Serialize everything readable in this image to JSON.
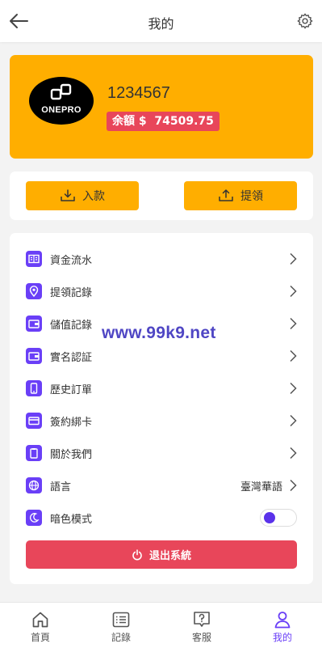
{
  "header": {
    "title": "我的",
    "back_icon": "arrow-left-icon",
    "settings_icon": "gear-icon"
  },
  "profile": {
    "logo_text": "ONEPRO",
    "username": "1234567",
    "balance_label": "余額",
    "balance_currency": "$",
    "balance_value": "74509.75"
  },
  "actions": {
    "deposit_label": "入款",
    "withdraw_label": "提領"
  },
  "menu": {
    "items": [
      {
        "label": "資金流水",
        "icon": "ledger-icon"
      },
      {
        "label": "提領記錄",
        "icon": "location-pin-icon"
      },
      {
        "label": "儲值記錄",
        "icon": "wallet-icon"
      },
      {
        "label": "實名認証",
        "icon": "id-card-icon"
      },
      {
        "label": "歷史訂單",
        "icon": "phone-icon"
      },
      {
        "label": "簽約綁卡",
        "icon": "credit-card-icon"
      },
      {
        "label": "關於我們",
        "icon": "clipboard-icon"
      },
      {
        "label": "語言",
        "icon": "globe-icon",
        "value": "臺灣華語"
      },
      {
        "label": "暗色模式",
        "icon": "moon-icon",
        "toggle": true
      }
    ],
    "logout_label": "退出系統"
  },
  "watermark": "www.99k9.net",
  "tabs": [
    {
      "label": "首頁",
      "icon": "home-icon"
    },
    {
      "label": "記錄",
      "icon": "list-icon"
    },
    {
      "label": "客服",
      "icon": "help-chat-icon"
    },
    {
      "label": "我的",
      "icon": "user-icon",
      "active": true
    }
  ],
  "colors": {
    "accent": "#ffae00",
    "primary": "#6a3ff7",
    "danger": "#e8465a",
    "background": "#f3f3f3"
  }
}
